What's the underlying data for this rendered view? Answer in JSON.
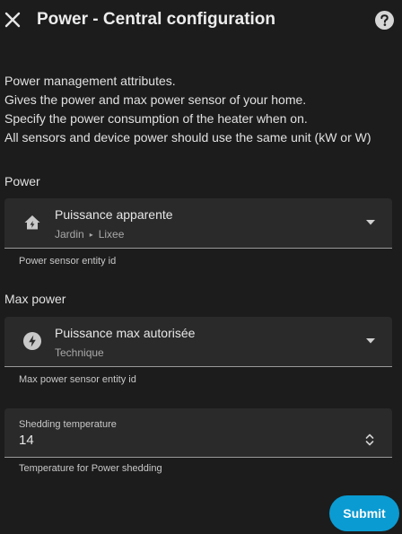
{
  "header": {
    "title": "Power - Central configuration",
    "close_icon": "close-icon",
    "help_icon": "help-circle-icon"
  },
  "description": {
    "lines": [
      "Power management attributes.",
      "Gives the power and max power sensor of your home.",
      "Specify the power consumption of the heater when on.",
      "All sensors and device power should use the same unit (kW or W)"
    ]
  },
  "power": {
    "section_label": "Power",
    "entity_name": "Puissance apparente",
    "area": "Jardin",
    "separator": "▸",
    "device": "Lixee",
    "helper": "Power sensor entity id",
    "icon": "home-lightning-icon"
  },
  "max_power": {
    "section_label": "Max power",
    "entity_name": "Puissance max autorisée",
    "area": "Technique",
    "helper": "Max power sensor entity id",
    "icon": "lightning-circle-icon"
  },
  "shedding": {
    "label": "Shedding temperature",
    "value": "14",
    "helper": "Temperature for Power shedding"
  },
  "actions": {
    "submit_label": "Submit"
  },
  "colors": {
    "background": "#1c1c1c",
    "field_bg": "#2a2a2a",
    "accent": "#0a9bd2"
  }
}
